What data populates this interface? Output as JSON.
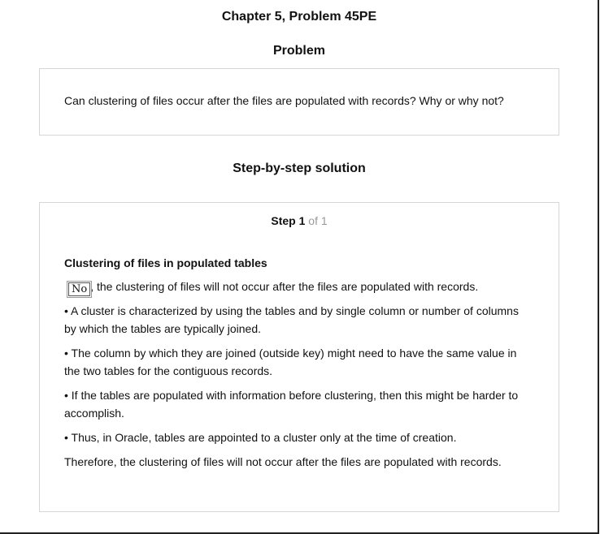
{
  "page": {
    "chapter_title": "Chapter 5, Problem 45PE"
  },
  "problem": {
    "heading": "Problem",
    "text": "Can clustering of files occur after the files are populated with records? Why or why not?"
  },
  "solution": {
    "heading": "Step-by-step solution",
    "step": {
      "label": "Step",
      "number": "1",
      "of": "of 1"
    },
    "content_heading": "Clustering of files in populated tables",
    "answer_box": "No",
    "answer_rest": ", the clustering of files will not occur after the files are populated with records.",
    "paragraphs": [
      "• A cluster is characterized by using the tables and by single column or number of columns by which the tables are typically joined.",
      "• The column by which they are joined (outside key) might need to have the same value in the two tables for the contiguous records.",
      "• If the tables are populated with information before clustering, then this might be harder to accomplish.",
      "• Thus, in Oracle, tables are appointed to a cluster only at the time of creation.",
      "Therefore, the clustering of files will not occur after the files are populated with records."
    ]
  }
}
